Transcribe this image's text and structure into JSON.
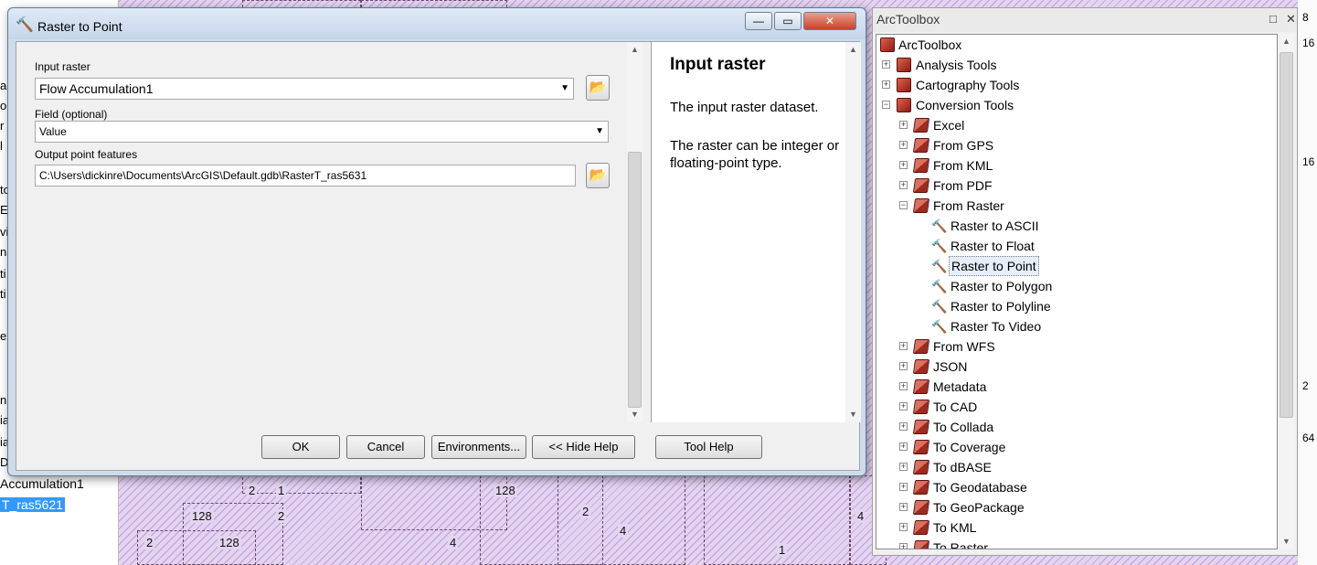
{
  "map": {
    "labels": [
      {
        "id": "n1",
        "text": "2"
      },
      {
        "id": "n2",
        "text": "1"
      },
      {
        "id": "n3",
        "text": "128"
      },
      {
        "id": "n4",
        "text": "128"
      },
      {
        "id": "n5",
        "text": "2"
      },
      {
        "id": "n6",
        "text": "2"
      },
      {
        "id": "n7",
        "text": "4"
      },
      {
        "id": "n8",
        "text": "4"
      },
      {
        "id": "n9",
        "text": "2"
      },
      {
        "id": "n10",
        "text": "128"
      },
      {
        "id": "n11",
        "text": "4"
      },
      {
        "id": "n12",
        "text": "1"
      }
    ]
  },
  "toc": {
    "fragments": [
      "ag",
      "o",
      "r",
      "l",
      "to",
      "E",
      "vi",
      "na",
      "ti",
      "ti",
      "e",
      "n",
      "ia",
      "ia",
      "Di"
    ],
    "layer1": "Accumulation1",
    "layer2": "T_ras5621"
  },
  "edge": {
    "numbers": [
      "8",
      "16",
      "16",
      "2",
      "64"
    ]
  },
  "dialog": {
    "title": "Raster to Point",
    "window_controls": {
      "minimize": "—",
      "maximize": "▭",
      "close": "✕"
    },
    "input_raster": {
      "label": "Input raster",
      "value": "Flow Accumulation1"
    },
    "field": {
      "label": "Field (optional)",
      "value": "Value"
    },
    "output": {
      "label": "Output point features",
      "value": "C:\\Users\\dickinre\\Documents\\ArcGIS\\Default.gdb\\RasterT_ras5631"
    },
    "help": {
      "heading": "Input raster",
      "p1": "The input raster dataset.",
      "p2": "The raster can be integer or floating-point type."
    },
    "buttons": {
      "ok": "OK",
      "cancel": "Cancel",
      "environments": "Environments...",
      "hide_help": "<< Hide Help",
      "tool_help": "Tool Help"
    }
  },
  "toolbox": {
    "title": "ArcToolbox",
    "controls": {
      "float": "□",
      "close": "✕"
    },
    "root": "ArcToolbox",
    "toolsets": {
      "analysis": "Analysis Tools",
      "cartography": "Cartography Tools",
      "conversion": "Conversion Tools"
    },
    "conversion_children": [
      "Excel",
      "From GPS",
      "From KML",
      "From PDF",
      "From Raster"
    ],
    "from_raster_tools": [
      "Raster to ASCII",
      "Raster to Float",
      "Raster to Point",
      "Raster to Polygon",
      "Raster to Polyline",
      "Raster To Video"
    ],
    "more_children": [
      "From WFS",
      "JSON",
      "Metadata",
      "To CAD",
      "To Collada",
      "To Coverage",
      "To dBASE",
      "To Geodatabase",
      "To GeoPackage",
      "To KML",
      "To Raster"
    ],
    "selected_tool": "Raster to Point"
  }
}
